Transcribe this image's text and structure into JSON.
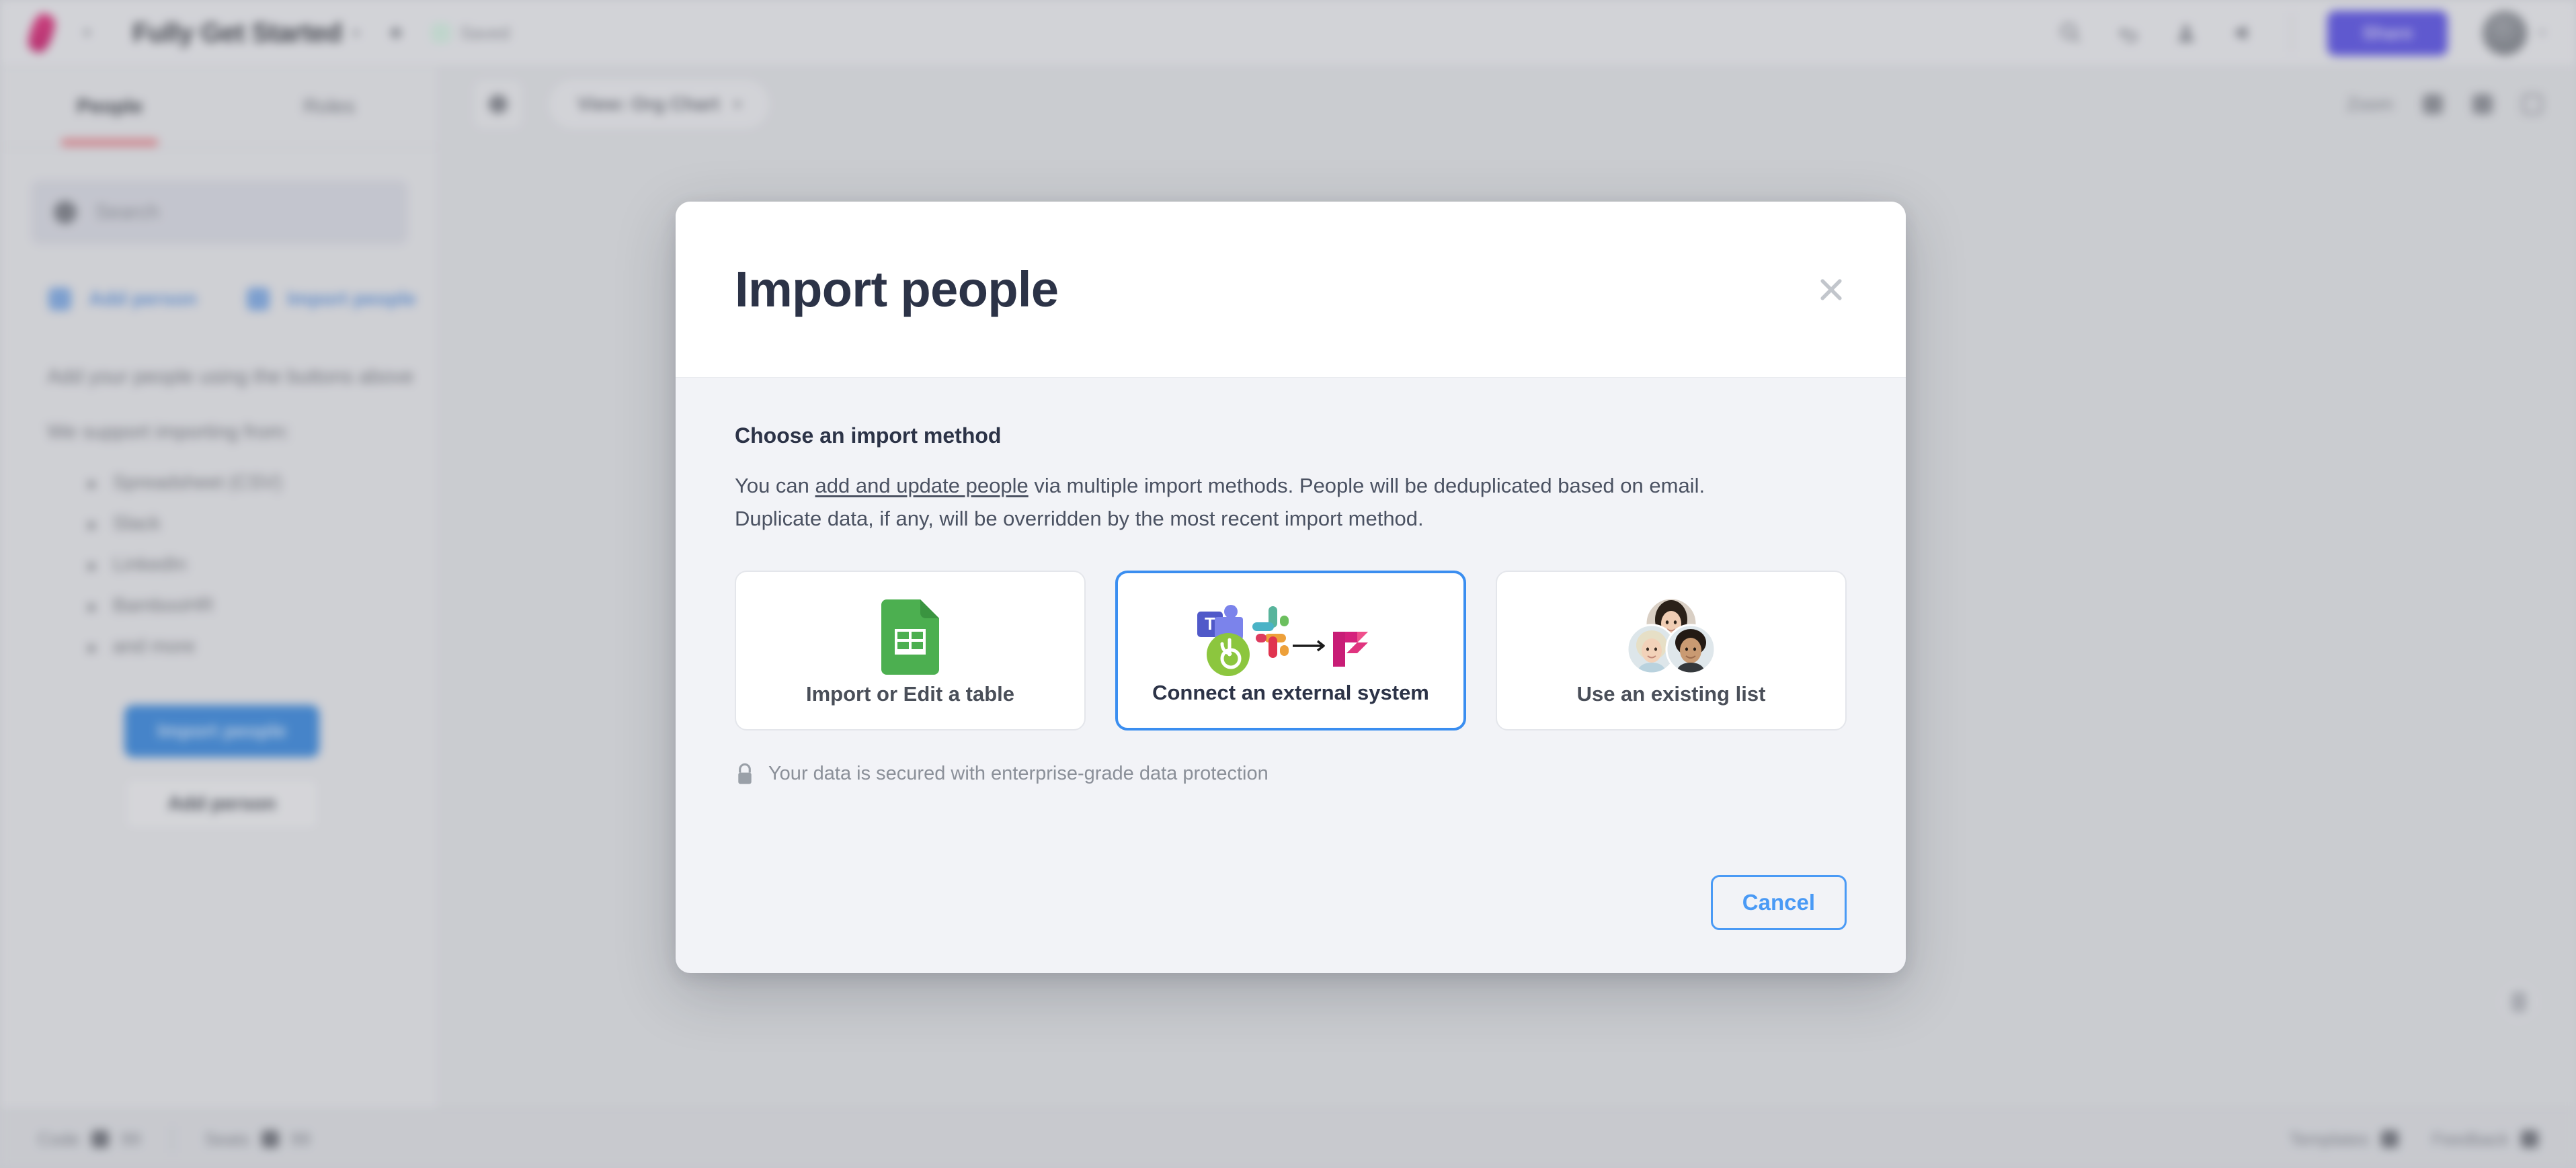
{
  "app": {
    "doc_title": "Fully Get Started",
    "saved_label": "Saved",
    "share_label": "Share",
    "tabs": [
      {
        "label": "People",
        "active": true
      },
      {
        "label": "Roles",
        "active": false
      }
    ],
    "search_placeholder": "Search",
    "sidebar_links": [
      {
        "label": "Add person",
        "icon": "add-person-icon"
      },
      {
        "label": "Import people",
        "icon": "import-people-icon"
      }
    ],
    "help_line_1": "Add your people using the buttons above",
    "help_line_2": "We support importing from:",
    "help_bullets": [
      "Spreadsheet (CSV)",
      "Slack",
      "LinkedIn",
      "BambooHR",
      "and more"
    ],
    "primary_button": "Import people",
    "secondary_button": "Add person",
    "view_pill": "View: Org Chart",
    "zoom_label": "Zoom",
    "status_left": [
      {
        "label": "Code",
        "value": "99"
      },
      {
        "label": "Seats",
        "value": "99"
      }
    ],
    "status_right": [
      {
        "label": "Templates"
      },
      {
        "label": "Feedback"
      }
    ]
  },
  "dialog": {
    "title": "Import people",
    "close_icon": "close-icon",
    "section_title": "Choose an import method",
    "desc_prefix": "You can ",
    "desc_link": "add and update people",
    "desc_suffix": " via multiple import methods. People will be deduplicated based on email. Duplicate data, if any, will be overridden by the most recent import method.",
    "cards": [
      {
        "id": "import-or-edit-a-table",
        "label": "Import or Edit a table",
        "icon": "google-sheets-icon",
        "selected": false
      },
      {
        "id": "connect-an-external-system",
        "label": "Connect an external system",
        "icon": "external-systems-arrow-icon",
        "selected": true
      },
      {
        "id": "use-an-existing-list",
        "label": "Use an existing list",
        "icon": "people-avatars-icon",
        "selected": false
      }
    ],
    "secured_icon": "lock-icon",
    "secured_text": "Your data is secured with enterprise-grade data protection",
    "cancel_label": "Cancel"
  },
  "colors": {
    "accent_blue": "#3b8ef0",
    "cancel_blue": "#4a9af5",
    "brand_pink": "#d52d7e",
    "share_purple": "#5a52e0",
    "title_navy": "#2c3347",
    "dialog_body_bg": "#f2f3f7"
  }
}
